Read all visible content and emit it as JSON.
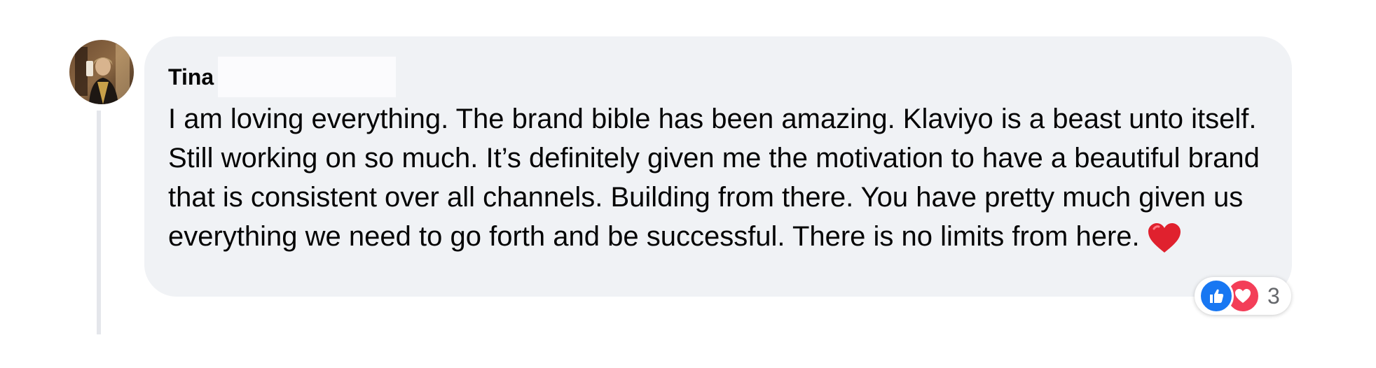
{
  "comment": {
    "author": "Tina",
    "text": "I am loving everything. The brand bible has been amazing. Klaviyo is a beast unto itself. Still working on so much. It’s definitely given me the motivation to have a beautiful brand that is consistent over all channels. Building from there. You have pretty much given us everything we need to go forth and be successful. There is no limits from here.",
    "emoji": "heart-emoji"
  },
  "reactions": {
    "types": [
      "like-icon",
      "love-icon"
    ],
    "count": "3"
  },
  "colors": {
    "bubble": "#f0f2f5",
    "like": "#1877f2",
    "love": "#f33e58",
    "heart": "#e0212e",
    "text": "#050505",
    "muted": "#65676b"
  }
}
